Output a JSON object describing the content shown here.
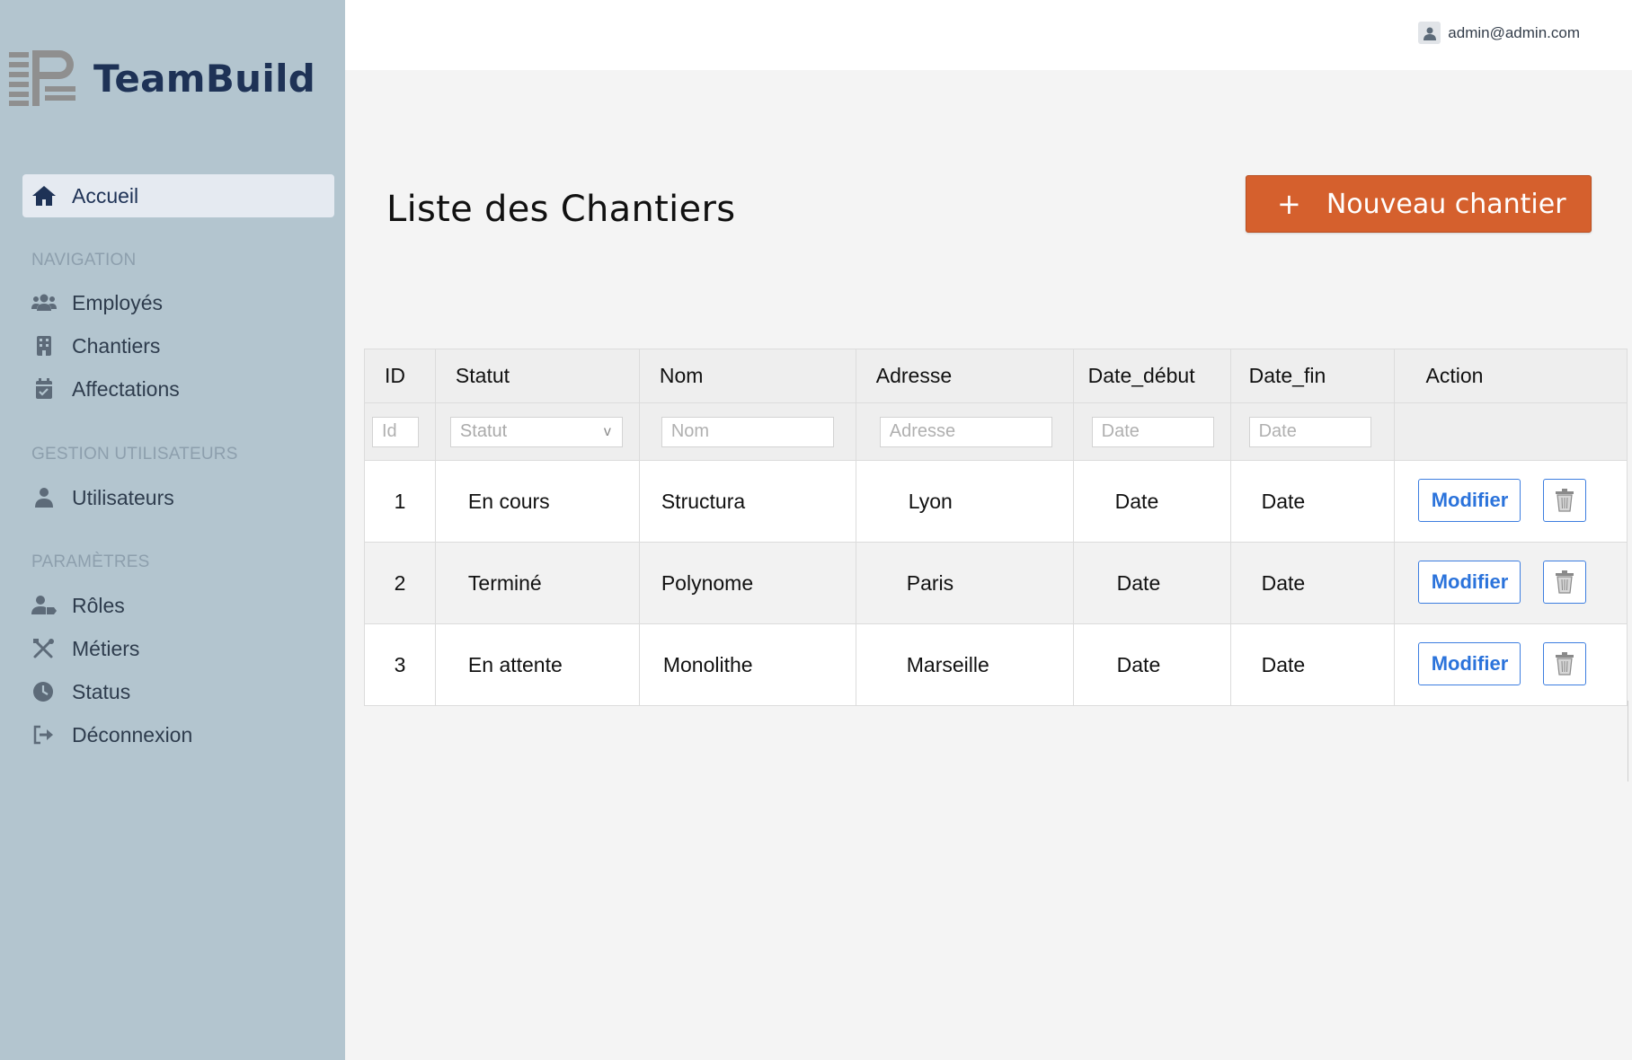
{
  "brand": {
    "name": "TeamBuild"
  },
  "sidebar": {
    "active": {
      "label": "Accueil",
      "icon": "home-icon"
    },
    "sections": [
      {
        "title": "NAVIGATION",
        "items": [
          {
            "label": "Employés",
            "icon": "users-icon"
          },
          {
            "label": "Chantiers",
            "icon": "building-icon"
          },
          {
            "label": "Affectations",
            "icon": "calendar-check-icon"
          }
        ]
      },
      {
        "title": "GESTION UTILISATEURS",
        "items": [
          {
            "label": "Utilisateurs",
            "icon": "user-icon"
          }
        ]
      },
      {
        "title": "PARAMÈTRES",
        "items": [
          {
            "label": "Rôles",
            "icon": "user-tag-icon"
          },
          {
            "label": "Métiers",
            "icon": "tools-icon"
          },
          {
            "label": "Status",
            "icon": "clock-icon"
          },
          {
            "label": "Déconnexion",
            "icon": "logout-icon"
          }
        ]
      }
    ]
  },
  "header": {
    "user_email": "admin@admin.com"
  },
  "main": {
    "title": "Liste des Chantiers",
    "new_button": {
      "plus": "+",
      "label": "Nouveau chantier"
    }
  },
  "table": {
    "headers": [
      "ID",
      "Statut",
      "Nom",
      "Adresse",
      "Date_début",
      "Date_fin",
      "Action"
    ],
    "filters": {
      "id": "Id",
      "statut": "Statut",
      "statut_chevron": "v",
      "nom": "Nom",
      "adresse": "Adresse",
      "date_debut": "Date",
      "date_fin": "Date"
    },
    "rows": [
      {
        "id": "1",
        "statut": "En cours",
        "nom": "Structura",
        "adresse": "Lyon",
        "date_debut": "Date",
        "date_fin": "Date",
        "edit": "Modifier"
      },
      {
        "id": "2",
        "statut": "Terminé",
        "nom": "Polynome",
        "adresse": "Paris",
        "date_debut": "Date",
        "date_fin": "Date",
        "edit": "Modifier"
      },
      {
        "id": "3",
        "statut": "En attente",
        "nom": "Monolithe",
        "adresse": "Marseille",
        "date_debut": "Date",
        "date_fin": "Date",
        "edit": "Modifier"
      }
    ]
  },
  "colors": {
    "sidebar_bg": "#b3c5cf",
    "brand_text": "#1e3256",
    "accent_orange": "#d5602d",
    "accent_blue": "#2b73db"
  }
}
